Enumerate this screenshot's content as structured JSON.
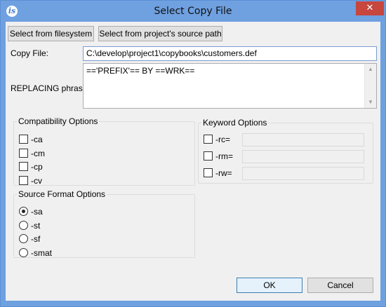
{
  "window": {
    "title": "Select Copy File",
    "app_icon_glyph": "is",
    "close_glyph": "✕"
  },
  "toolbar": {
    "select_filesystem_label": "Select from filesystem",
    "select_source_path_label": "Select from project's source path"
  },
  "form": {
    "copy_file_label": "Copy File:",
    "copy_file_value": "C:\\develop\\project1\\copybooks\\customers.def",
    "replacing_label": "REPLACING phrase:",
    "replacing_value": "=='PREFIX'== BY ==WRK=="
  },
  "compatibility": {
    "title": "Compatibility Options",
    "options": [
      {
        "label": "-ca",
        "checked": false
      },
      {
        "label": "-cm",
        "checked": false
      },
      {
        "label": "-cp",
        "checked": false
      },
      {
        "label": "-cv",
        "checked": false
      }
    ]
  },
  "keyword": {
    "title": "Keyword Options",
    "options": [
      {
        "label": "-rc=",
        "checked": false,
        "value": ""
      },
      {
        "label": "-rm=",
        "checked": false,
        "value": ""
      },
      {
        "label": "-rw=",
        "checked": false,
        "value": ""
      }
    ]
  },
  "source_format": {
    "title": "Source Format Options",
    "options": [
      {
        "label": "-sa",
        "selected": true
      },
      {
        "label": "-st",
        "selected": false
      },
      {
        "label": "-sf",
        "selected": false
      },
      {
        "label": "-smat",
        "selected": false
      }
    ]
  },
  "footer": {
    "ok_label": "OK",
    "cancel_label": "Cancel"
  },
  "icons": {
    "app": "isystem-app-icon",
    "close": "close-icon",
    "scroll_up": "scroll-up-arrow-icon",
    "scroll_down": "scroll-down-arrow-icon"
  }
}
